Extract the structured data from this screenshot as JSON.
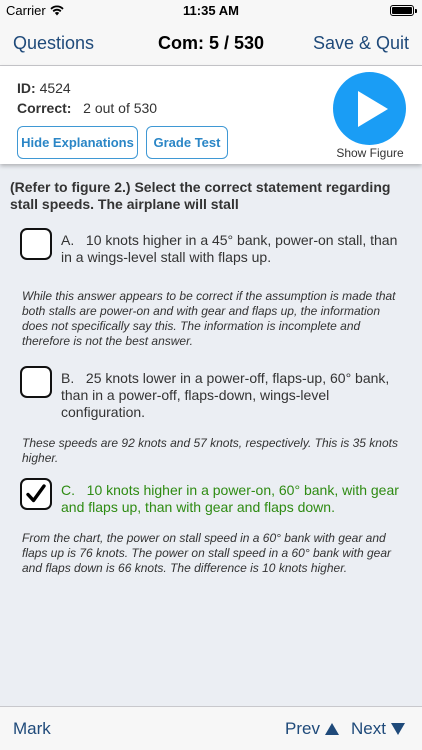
{
  "status_bar": {
    "carrier": "Carrier",
    "time": "11:35 AM"
  },
  "nav": {
    "back_label": "Questions",
    "title": "Com: 5 / 530",
    "save_label": "Save & Quit"
  },
  "info": {
    "id_label": "ID:",
    "id_value": "4524",
    "correct_label": "Correct:",
    "correct_value": "2 out of 530",
    "hide_explanations": "Hide Explanations",
    "grade_test": "Grade Test",
    "show_figure": "Show Figure"
  },
  "question": {
    "text": "(Refer to figure 2.) Select the correct statement regarding stall speeds. The airplane will stall"
  },
  "answers": [
    {
      "letter": "A.",
      "text": "10 knots higher in a 45° bank, power-on stall, than in a wings-level stall with flaps up.",
      "checked": false,
      "explanation": "While this answer appears to be correct if the assumption is made that both stalls are power-on and with gear and flaps up, the information does not specifically say this.  The information is incomplete and therefore is not the best answer."
    },
    {
      "letter": "B.",
      "text": "25 knots lower in a power-off, flaps-up, 60° bank, than in a power-off, flaps-down, wings-level configuration.",
      "checked": false,
      "explanation": "These speeds are 92 knots and 57 knots, respectively. This is 35 knots higher."
    },
    {
      "letter": "C.",
      "text": "10 knots higher in a power-on, 60° bank, with gear and flaps up, than with gear and flaps down.",
      "checked": true,
      "explanation": "From the chart, the power on stall speed in a 60° bank with gear and flaps up is 76 knots.  The power on stall speed in a 60° bank with gear and flaps down is 66 knots.  The difference is 10 knots higher."
    }
  ],
  "toolbar": {
    "mark": "Mark",
    "prev": "Prev",
    "next": "Next"
  },
  "colors": {
    "accent": "#1a9df5",
    "pill_border": "#3f98d4",
    "nav_text": "#1f4a7a",
    "correct_green": "#2e8b12"
  }
}
